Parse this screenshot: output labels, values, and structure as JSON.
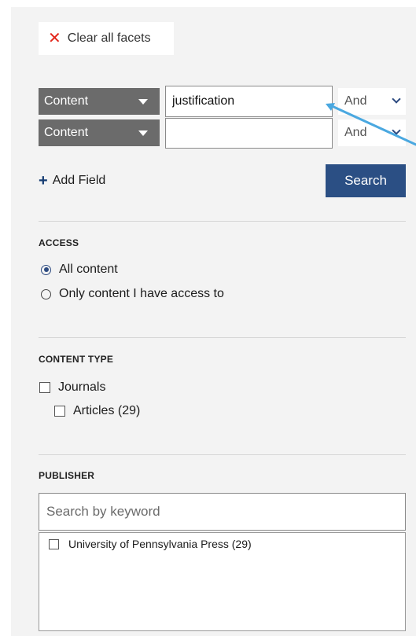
{
  "toolbar": {
    "clear_label": "Clear all facets"
  },
  "query_rows": [
    {
      "field": "Content",
      "value": "justification",
      "operator": "And"
    },
    {
      "field": "Content",
      "value": "",
      "operator": "And"
    }
  ],
  "add_field_label": "Add Field",
  "search_label": "Search",
  "facets": {
    "access": {
      "title": "ACCESS",
      "options": [
        {
          "label": "All content",
          "selected": true
        },
        {
          "label": "Only content I have access to",
          "selected": false
        }
      ]
    },
    "content_type": {
      "title": "CONTENT TYPE",
      "options": [
        {
          "label": "Journals",
          "checked": false
        },
        {
          "label": "Articles (29)",
          "checked": false
        }
      ]
    },
    "publisher": {
      "title": "PUBLISHER",
      "search_placeholder": "Search by keyword",
      "items": [
        {
          "label": "University of Pennsylvania Press (29)",
          "checked": false
        }
      ]
    }
  },
  "annotation": {
    "color": "#4aa8e0",
    "icon": "pointer-arrow"
  }
}
